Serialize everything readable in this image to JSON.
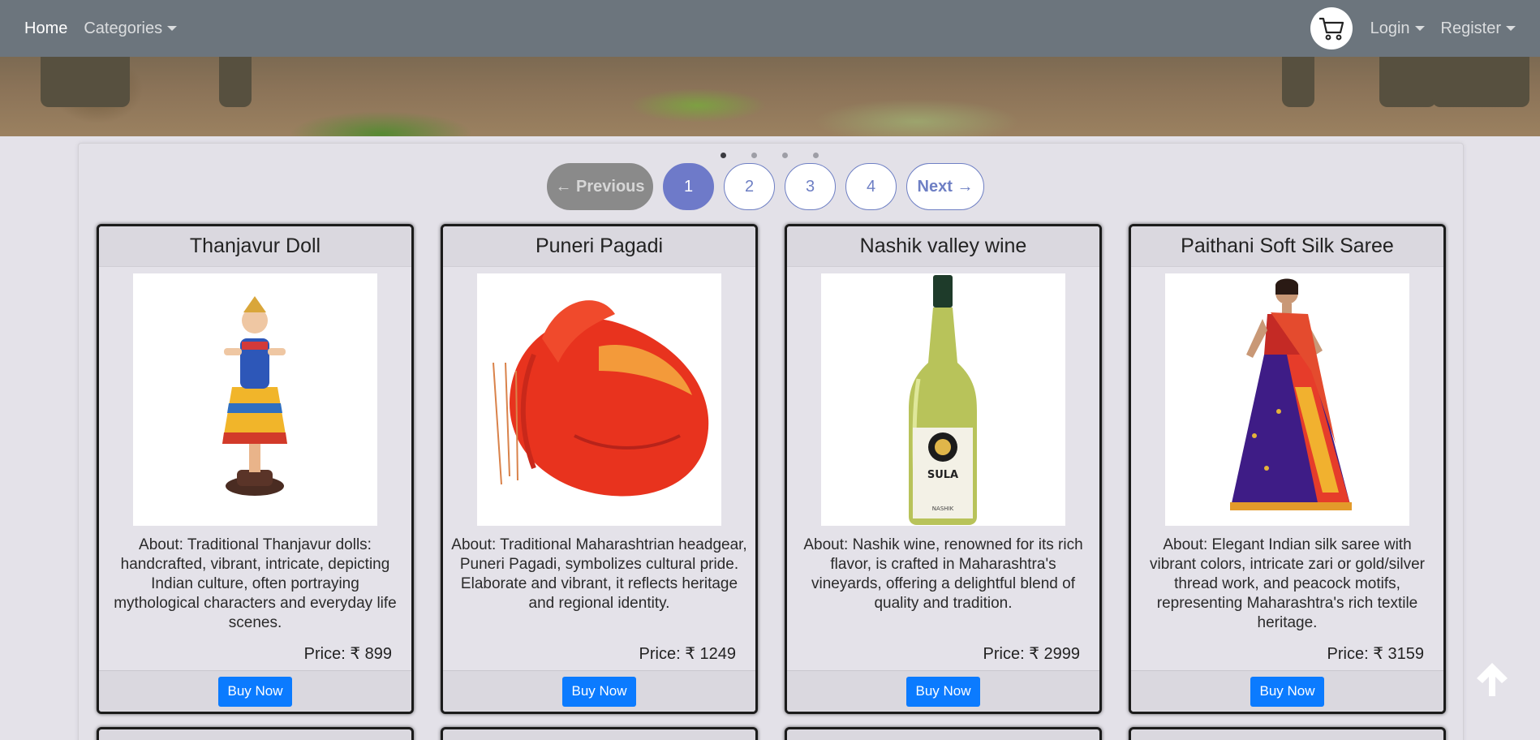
{
  "nav": {
    "home": "Home",
    "categories": "Categories",
    "login": "Login",
    "register": "Register",
    "cart_icon": "shopping-cart-icon"
  },
  "pagination": {
    "previous": "← Previous",
    "pages": [
      "1",
      "2",
      "3",
      "4"
    ],
    "active_page": "1",
    "next": "Next →",
    "carousel_dots": 4,
    "active_dot": 1
  },
  "products": [
    {
      "title": "Thanjavur Doll",
      "about": "About: Traditional Thanjavur dolls: handcrafted, vibrant, intricate, depicting Indian culture, often portraying mythological characters and everyday life scenes.",
      "price": "Price: ₹ 899",
      "button": "Buy Now"
    },
    {
      "title": "Puneri Pagadi",
      "about": "About: Traditional Maharashtrian headgear, Puneri Pagadi, symbolizes cultural pride. Elaborate and vibrant, it reflects heritage and regional identity.",
      "price": "Price: ₹ 1249",
      "button": "Buy Now"
    },
    {
      "title": "Nashik valley wine",
      "about": "About: Nashik wine, renowned for its rich flavor, is crafted in Maharashtra's vineyards, offering a delightful blend of quality and tradition.",
      "price": "Price: ₹ 2999",
      "button": "Buy Now",
      "label_text": "SULA",
      "label_sub": "NASHIK"
    },
    {
      "title": "Paithani Soft Silk Saree",
      "about": "About: Elegant Indian silk saree with vibrant colors, intricate zari or gold/silver thread work, and peacock motifs, representing Maharashtra's rich textile heritage.",
      "price": "Price: ₹ 3159",
      "button": "Buy Now"
    }
  ],
  "colors": {
    "navbar": "#6c757d",
    "accent": "#6e7ac9",
    "buy_button": "#0b7bff",
    "page_bg": "#e4e2e9"
  },
  "scroll_top_icon": "arrow-up-icon"
}
